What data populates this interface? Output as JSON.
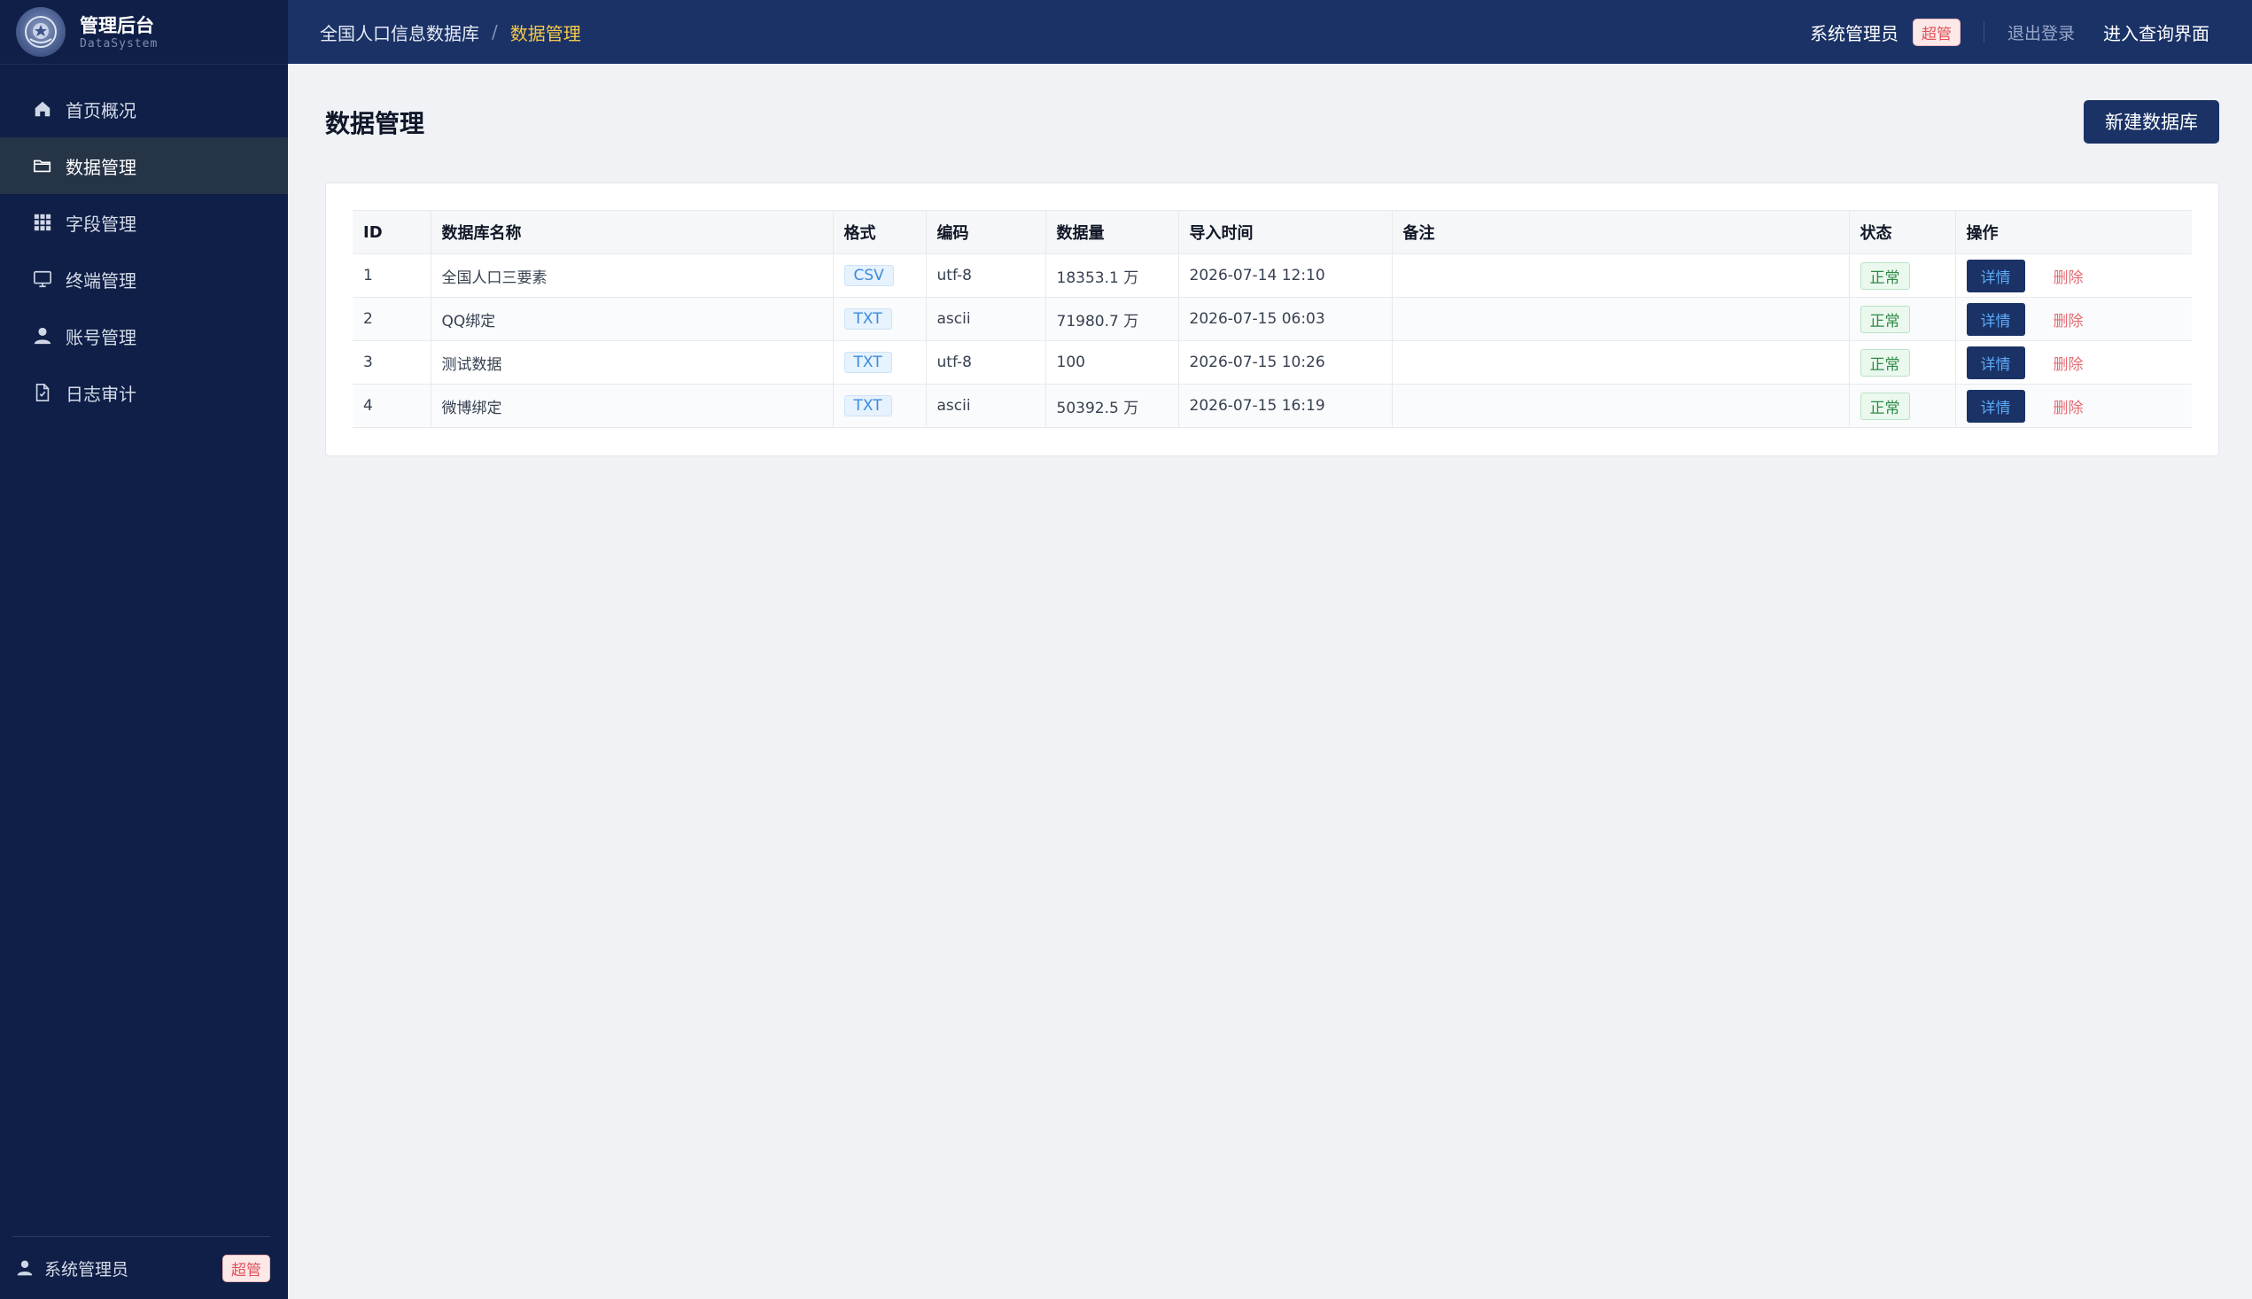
{
  "sidebar": {
    "brand_title": "管理后台",
    "brand_sub": "DataSystem",
    "items": [
      {
        "label": "首页概况",
        "icon": "home-icon"
      },
      {
        "label": "数据管理",
        "icon": "folder-icon",
        "active": true
      },
      {
        "label": "字段管理",
        "icon": "grid-icon"
      },
      {
        "label": "终端管理",
        "icon": "monitor-icon"
      },
      {
        "label": "账号管理",
        "icon": "user-icon"
      },
      {
        "label": "日志审计",
        "icon": "document-icon"
      }
    ],
    "footer_user": "系统管理员",
    "footer_badge": "超管"
  },
  "topbar": {
    "crumb_root": "全国人口信息数据库",
    "crumb_sep": "/",
    "crumb_current": "数据管理",
    "user": "系统管理员",
    "badge": "超管",
    "logout": "退出登录",
    "enter": "进入查询界面"
  },
  "main": {
    "title": "数据管理",
    "new_button": "新建数据库",
    "columns": [
      "ID",
      "数据库名称",
      "格式",
      "编码",
      "数据量",
      "导入时间",
      "备注",
      "状态",
      "操作"
    ],
    "rows": [
      {
        "id": "1",
        "name": "全国人口三要素",
        "format": "CSV",
        "encoding": "utf-8",
        "count": "18353.1 万",
        "time": "2026-07-14 12:10",
        "note": "",
        "status": "正常"
      },
      {
        "id": "2",
        "name": "QQ绑定",
        "format": "TXT",
        "encoding": "ascii",
        "count": "71980.7 万",
        "time": "2026-07-15 06:03",
        "note": "",
        "status": "正常"
      },
      {
        "id": "3",
        "name": "测试数据",
        "format": "TXT",
        "encoding": "utf-8",
        "count": "100",
        "time": "2026-07-15 10:26",
        "note": "",
        "status": "正常"
      },
      {
        "id": "4",
        "name": "微博绑定",
        "format": "TXT",
        "encoding": "ascii",
        "count": "50392.5 万",
        "time": "2026-07-15 16:19",
        "note": "",
        "status": "正常"
      }
    ],
    "detail_label": "详情",
    "delete_label": "删除"
  },
  "colors": {
    "sidebar_bg": "#0f1f47",
    "topbar_bg": "#1a3266",
    "accent_breadcrumb": "#f5c84b",
    "danger": "#e66b72"
  }
}
